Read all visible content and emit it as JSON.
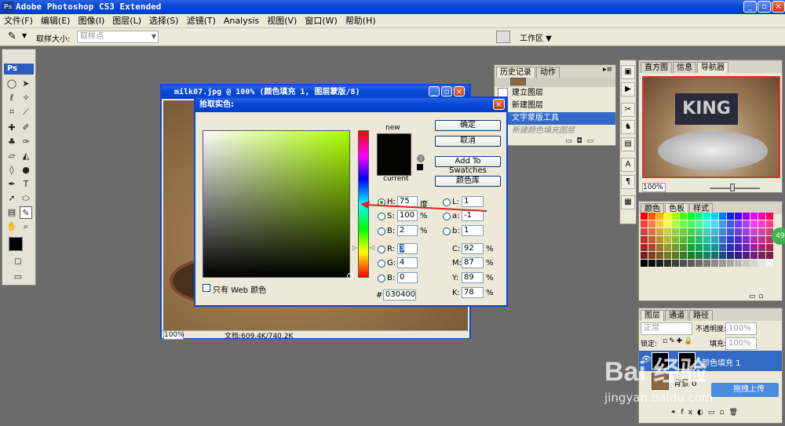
{
  "app": {
    "title": "Adobe Photoshop CS3 Extended"
  },
  "menu": {
    "items": [
      "文件(F)",
      "编辑(E)",
      "图像(I)",
      "图层(L)",
      "选择(S)",
      "滤镜(T)",
      "Analysis",
      "视图(V)",
      "窗口(W)",
      "帮助(H)"
    ]
  },
  "options": {
    "sample_size_label": "取样大小:",
    "sample_size_value": "取样点",
    "workspace_label": "工作区"
  },
  "history_panel": {
    "tabs": [
      "历史记录",
      "动作"
    ],
    "items": [
      "建立图层",
      "新建图层",
      "文字蒙版工具",
      "新建颜色填充图层"
    ],
    "selected_index": 2
  },
  "navigator_panel": {
    "tabs": [
      "直方图",
      "信息",
      "导航器"
    ],
    "zoom": "100%"
  },
  "swatches_panel": {
    "tabs": [
      "颜色",
      "色板",
      "样式"
    ]
  },
  "layers_panel": {
    "tabs": [
      "图层",
      "通道",
      "路径"
    ],
    "blend_mode": "正常",
    "opacity_label": "不透明度:",
    "opacity_value": "100%",
    "lock_label": "锁定:",
    "fill_label": "填充:",
    "fill_value": "100%",
    "layer_name": "颜色填充 1",
    "bg_label": "背景 0"
  },
  "document": {
    "title": "milk07.jpg @ 100% (颜色填充 1, 图层蒙版/8)",
    "zoom": "100%",
    "doc_info": "文档:609.4K/740.2K"
  },
  "color_picker": {
    "title": "拾取实色:",
    "new_label": "new",
    "current_label": "current",
    "buttons": {
      "ok": "确定",
      "cancel": "取消",
      "add_swatches": "Add To Swatches",
      "color_libraries": "颜色库"
    },
    "web_only_label": "只有 Web 颜色",
    "fields": {
      "H": {
        "value": "75",
        "unit": "度"
      },
      "S": {
        "value": "100",
        "unit": "%"
      },
      "B": {
        "value": "2",
        "unit": "%"
      },
      "R": {
        "value": "3"
      },
      "G": {
        "value": "4"
      },
      "Bl": {
        "value": "0"
      },
      "L": {
        "value": "1"
      },
      "a": {
        "value": "-1"
      },
      "b": {
        "value": "1"
      },
      "C": {
        "value": "92",
        "unit": "%"
      },
      "M": {
        "value": "87",
        "unit": "%"
      },
      "Y": {
        "value": "89",
        "unit": "%"
      },
      "K": {
        "value": "78",
        "unit": "%"
      }
    },
    "hex": "030400",
    "hue_color": "#aaff00",
    "selected_color": "#030400"
  },
  "watermark": {
    "line1": "Bai 经验",
    "line2": "jingyan.baidu.com",
    "upload": "拖拽上传"
  },
  "colors": {
    "xp_blue": "#0a48d8",
    "selection_blue": "#316ac5",
    "annotation_red": "#e02020"
  }
}
